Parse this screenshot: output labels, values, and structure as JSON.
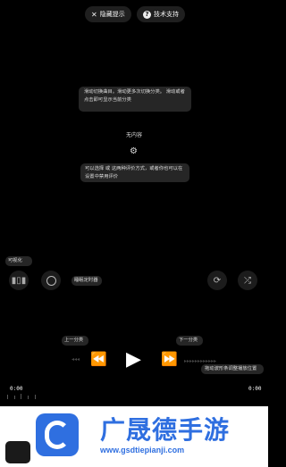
{
  "top": {
    "hide_tips_label": "隐藏提示",
    "support_label": "技术支持"
  },
  "center": {
    "tip_swipe": "滑动切换曲目。滑动更多次切换分类。 滑动或者点击即可显示当前分类",
    "empty_label": "无内容",
    "tip_rating": "可以选择 或 这两种评价方式，或者你也可以在设置中禁用评价"
  },
  "controls": {
    "visualize_tip": "可视化",
    "sleep_timer_tip": "睡眠定时器",
    "prev_category_tip": "上一分类",
    "next_category_tip": "下一分类",
    "waveform_tip": "拖动波形条调整播放位置",
    "time_elapsed": "0:00",
    "time_total": "0:00"
  },
  "watermark": {
    "brand_text": "广晟德手游",
    "url_text": "www.gsdtiepianji.com"
  },
  "colors": {
    "background": "#000000",
    "pill_bg": "#1f1f1f",
    "tip_bg": "#262626",
    "watermark_blue": "#2f6fe0"
  }
}
